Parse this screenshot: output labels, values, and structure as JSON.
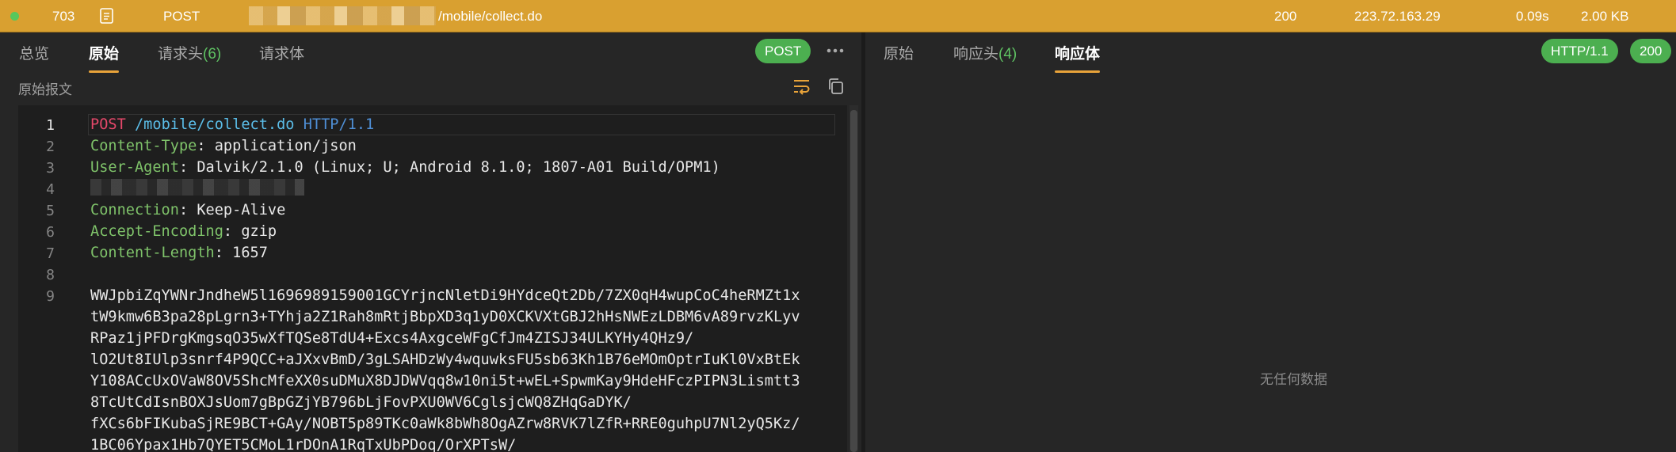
{
  "request_row": {
    "id": "703",
    "method": "POST",
    "path": "/mobile/collect.do",
    "status_code": "200",
    "ip": "223.72.163.29",
    "time": "0.09s",
    "size": "2.00 KB",
    "icons": {
      "status": "green-dot-icon",
      "type": "document-icon"
    }
  },
  "left_panel": {
    "tabs": [
      {
        "label": "总览",
        "count": ""
      },
      {
        "label": "原始",
        "count": ""
      },
      {
        "label": "请求头",
        "count": "(6)"
      },
      {
        "label": "请求体",
        "count": ""
      }
    ],
    "active_tab": "原始",
    "method_badge": "POST",
    "section_label": "原始报文",
    "line_numbers": [
      "1",
      "2",
      "3",
      "4",
      "5",
      "6",
      "7",
      "8",
      "9"
    ],
    "request_line": {
      "method": "POST",
      "path": "/mobile/collect.do",
      "protocol": "HTTP/1.1"
    },
    "headers": [
      {
        "key": "Content-Type",
        "value": "application/json"
      },
      {
        "key": "User-Agent",
        "value": "Dalvik/2.1.0 (Linux; U; Android 8.1.0; 1807-A01 Build/OPM1)"
      },
      {
        "key": "Connection",
        "value": "Keep-Alive"
      },
      {
        "key": "Accept-Encoding",
        "value": "gzip"
      },
      {
        "key": "Content-Length",
        "value": "1657"
      }
    ],
    "body_lines": [
      "WWJpbiZqYWNrJndheW5l1696989159001GCYrjncNletDi9HYdceQt2Db/7ZX0qH4wupCoC4heRMZt1x",
      "tW9kmw6B3pa28pLgrn3+TYhja2Z1Rah8mRtjBbpXD3q1yD0XCKVXtGBJ2hHsNWEzLDBM6vA89rvzKLyv",
      "RPaz1jPFDrgKmgsqO35wXfTQSe8TdU4+Excs4AxgceWFgCfJm4ZISJ34ULKYHy4QHz9/",
      "lO2Ut8IUlp3snrf4P9QCC+aJXxvBmD/3gLSAHDzWy4wquwksFU5sb63Kh1B76eMOmOptrIuKl0VxBtEk",
      "Y108ACcUxOVaW8OV5ShcMfeXX0suDMuX8DJDWVqq8w10ni5t+wEL+SpwmKay9HdeHFczPIPN3Lismtt3",
      "8TcUtCdIsnBOXJsUom7gBpGZjYB796bLjFovPXU0WV6CglsjcWQ8ZHqGaDYK/",
      "fXCs6bFIKubaSjRE9BCT+GAy/NOBT5p89TKc0aWk8bWh8OgAZrw8RVK7lZfR+RRE0guhpU7Nl2yQ5Kz/",
      "1BC06Ypax1Hb7QYET5CMoL1rDOnA1RqTxUbPDoq/OrXPTsW/"
    ],
    "icons": {
      "more": "more-horizontal-icon",
      "wrap": "wrap-lines-icon",
      "copy": "copy-icon"
    }
  },
  "right_panel": {
    "tabs": [
      {
        "label": "原始",
        "count": ""
      },
      {
        "label": "响应头",
        "count": "(4)"
      },
      {
        "label": "响应体",
        "count": ""
      }
    ],
    "active_tab": "响应体",
    "protocol_badge": "HTTP/1.1",
    "status_badge": "200",
    "empty_text": "无任何数据"
  },
  "colors": {
    "selected_row": "#d9a030",
    "accent_underline": "#e8a33a",
    "badge_green": "#4caf50",
    "method_red": "#e5486a",
    "header_key_green": "#7fc36a",
    "path_blue": "#5bbde8"
  }
}
